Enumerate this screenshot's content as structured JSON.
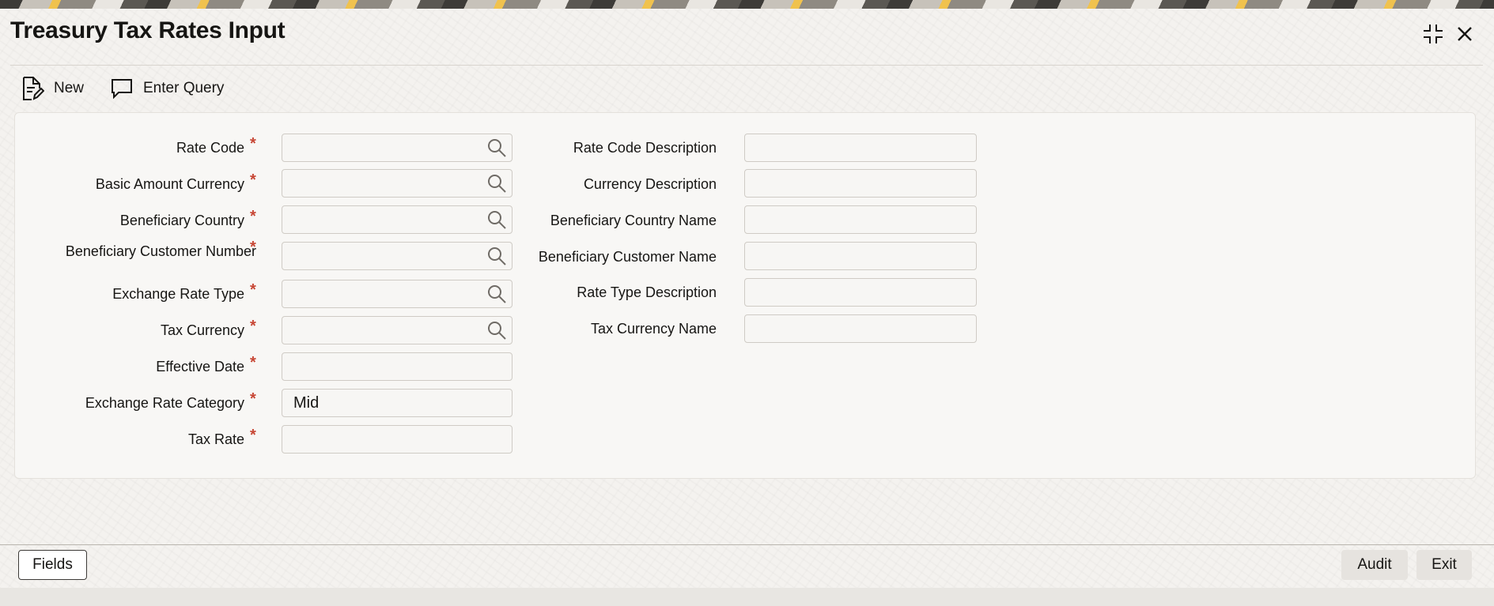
{
  "window": {
    "title": "Treasury Tax Rates Input"
  },
  "toolbar": {
    "new_label": "New",
    "enter_query_label": "Enter Query"
  },
  "form": {
    "left_fields": [
      {
        "label": "Rate Code",
        "required": "*",
        "value": ""
      },
      {
        "label": "Basic Amount Currency",
        "required": "*",
        "value": ""
      },
      {
        "label": "Beneficiary Country",
        "required": "*",
        "value": ""
      },
      {
        "label": "Beneficiary Customer Number",
        "required": "*",
        "value": ""
      },
      {
        "label": "Exchange Rate Type",
        "required": "*",
        "value": ""
      },
      {
        "label": "Tax Currency",
        "required": "*",
        "value": ""
      },
      {
        "label": "Effective Date",
        "required": "*",
        "value": ""
      },
      {
        "label": "Exchange Rate Category",
        "required": "*",
        "value": "Mid"
      },
      {
        "label": "Tax Rate",
        "required": "*",
        "value": ""
      }
    ],
    "right_fields": [
      {
        "label": "Rate Code Description",
        "value": ""
      },
      {
        "label": "Currency Description",
        "value": ""
      },
      {
        "label": "Beneficiary Country Name",
        "value": ""
      },
      {
        "label": "Beneficiary Customer Name",
        "value": ""
      },
      {
        "label": "Rate Type Description",
        "value": ""
      },
      {
        "label": "Tax Currency Name",
        "value": ""
      }
    ]
  },
  "footer": {
    "fields_label": "Fields",
    "audit_label": "Audit",
    "exit_label": "Exit"
  },
  "colors": {
    "required_marker": "#c74634",
    "panel_background": "#f8f7f5",
    "button_secondary": "#e6e3df"
  },
  "icons": {
    "new": "new-document-icon",
    "enter_query": "speech-bubble-icon",
    "restore": "restore-window-icon",
    "close": "close-icon",
    "lookup": "search-icon"
  }
}
